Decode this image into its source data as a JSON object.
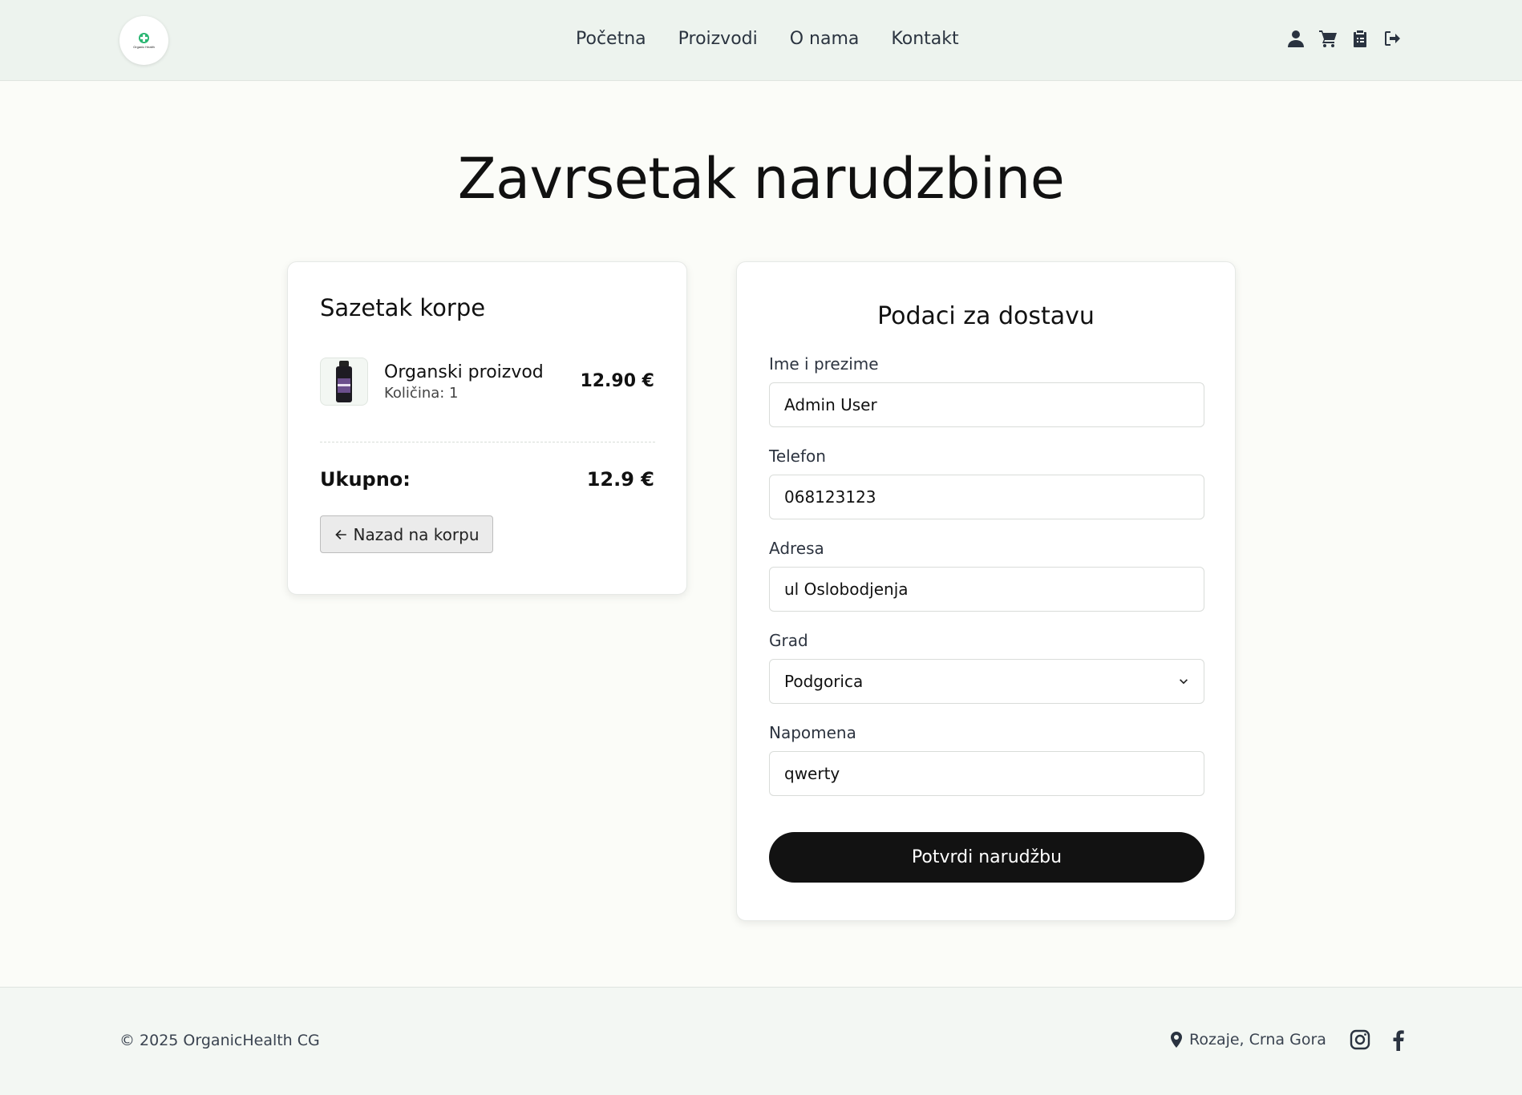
{
  "header": {
    "logo_text": "Organic Health",
    "nav": [
      {
        "label": "Početna"
      },
      {
        "label": "Proizvodi"
      },
      {
        "label": "O nama"
      },
      {
        "label": "Kontakt"
      }
    ],
    "icons": [
      "user-icon",
      "cart-icon",
      "orders-icon",
      "logout-icon"
    ]
  },
  "page": {
    "title": "Zavrsetak narudzbine"
  },
  "summary": {
    "title": "Sazetak korpe",
    "item": {
      "name": "Organski proizvod",
      "quantity_text": "Količina: 1",
      "price": "12.90 €"
    },
    "total_label": "Ukupno:",
    "total_value": "12.9 €",
    "back_label": "Nazad na korpu"
  },
  "delivery": {
    "title": "Podaci za dostavu",
    "fields": {
      "name": {
        "label": "Ime i prezime",
        "value": "Admin User"
      },
      "phone": {
        "label": "Telefon",
        "value": "068123123"
      },
      "address": {
        "label": "Adresa",
        "value": "ul Oslobodjenja"
      },
      "city": {
        "label": "Grad",
        "value": "Podgorica"
      },
      "note": {
        "label": "Napomena",
        "value": "qwerty"
      }
    },
    "confirm_label": "Potvrdi narudžbu"
  },
  "footer": {
    "copyright": "© 2025 OrganicHealth CG",
    "location": "Rozaje, Crna Gora",
    "social": [
      "instagram-icon",
      "facebook-icon"
    ]
  },
  "colors": {
    "header_bg": "#edf3ee",
    "page_bg": "#fbfcf8",
    "accent_green": "#2bb673",
    "button_dark": "#121212"
  }
}
